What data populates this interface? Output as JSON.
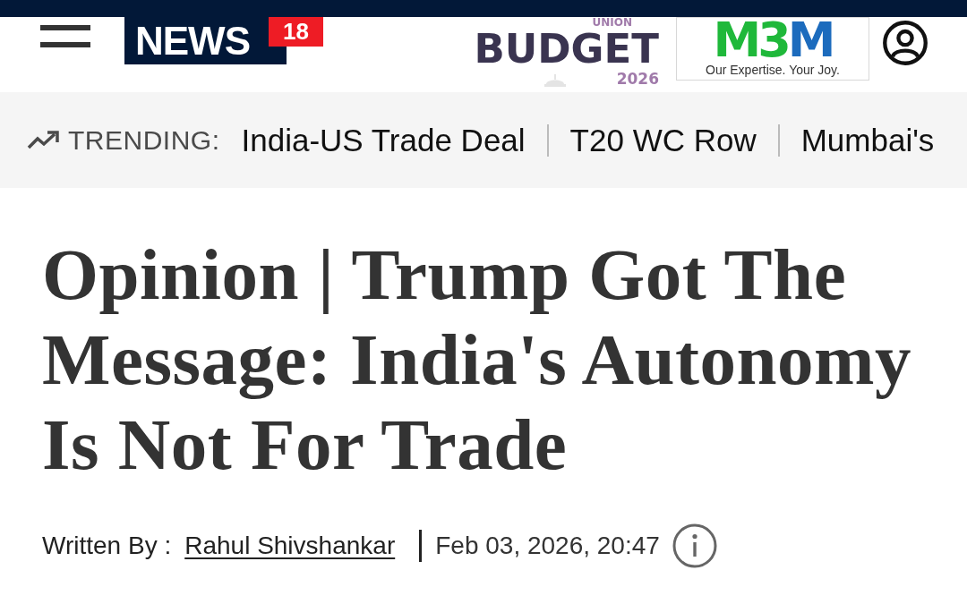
{
  "header": {
    "logo": {
      "text": "NEWS",
      "badge": "18"
    },
    "budget_logo": {
      "top": "UNION",
      "title": "BUDGET",
      "year": "2026"
    },
    "ad": {
      "brand": [
        {
          "text": "M3",
          "color": "#1fb83a"
        },
        {
          "text": "M",
          "color": "#1c6bbd"
        }
      ],
      "tagline": "Our Expertise. Your Joy."
    }
  },
  "trending": {
    "label": "TRENDING:",
    "items": [
      "India-US Trade Deal",
      "T20 WC Row",
      "Mumbai's"
    ]
  },
  "article": {
    "headline": "Opinion | Trump Got The Message: India's Autonomy Is Not For Trade",
    "byline": {
      "label": "Written By :",
      "author": "Rahul Shivshankar",
      "date": "Feb 03, 2026, 20:47"
    }
  }
}
